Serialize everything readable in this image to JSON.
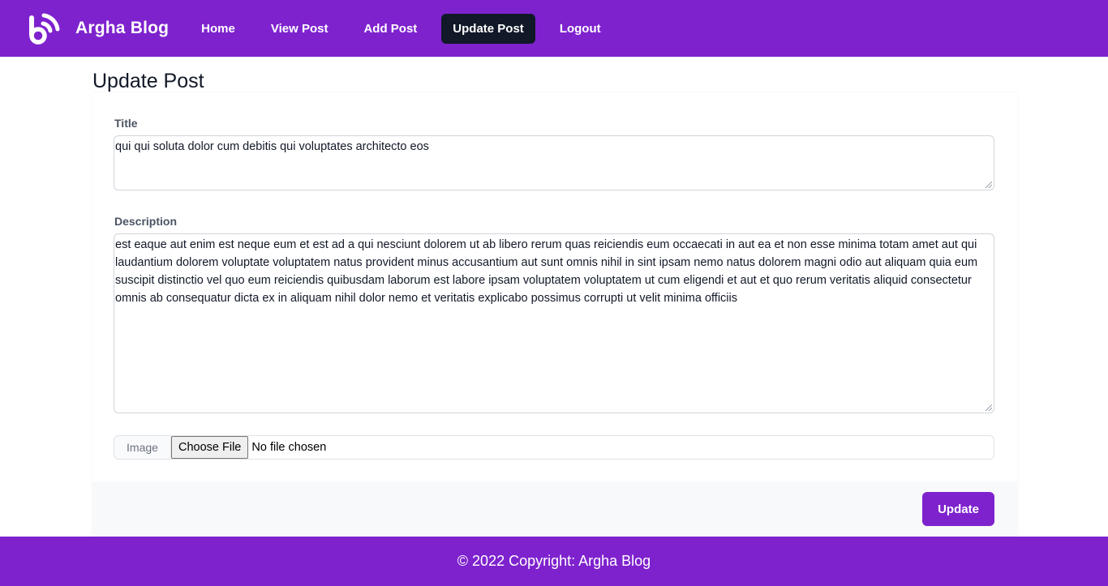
{
  "navbar": {
    "brand_name": "Argha Blog",
    "logo_icon": "blog-logo-icon",
    "items": [
      {
        "label": "Home",
        "active": false
      },
      {
        "label": "View Post",
        "active": false
      },
      {
        "label": "Add Post",
        "active": false
      },
      {
        "label": "Update Post",
        "active": true
      },
      {
        "label": "Logout",
        "active": false
      }
    ]
  },
  "page": {
    "title": "Update Post"
  },
  "form": {
    "title_label": "Title",
    "title_value": "qui qui soluta dolor cum debitis qui voluptates architecto eos",
    "description_label": "Description",
    "description_value": "est eaque aut enim est neque eum et est ad a qui nesciunt dolorem ut ab libero rerum quas reiciendis eum occaecati in aut ea et non esse minima totam amet aut qui laudantium dolorem voluptate voluptatem natus provident minus accusantium aut sunt omnis nihil in sint ipsam nemo natus dolorem magni odio aut aliquam quia eum suscipit distinctio vel quo eum reiciendis quibusdam laborum est labore ipsam voluptatem voluptatem ut cum eligendi et aut et quo rerum veritatis aliquid consectetur omnis ab consequatur dicta ex in aliquam nihil dolor nemo et veritatis explicabo possimus corrupti ut velit minima officiis",
    "image_label": "Image",
    "file_button_label": "Choose File",
    "file_status": "No file chosen",
    "submit_label": "Update"
  },
  "footer": {
    "text": "© 2022 Copyright: Argha Blog"
  },
  "colors": {
    "brand": "#7e22ce",
    "active_nav": "#111827",
    "card_footer": "#f8f9fa"
  }
}
